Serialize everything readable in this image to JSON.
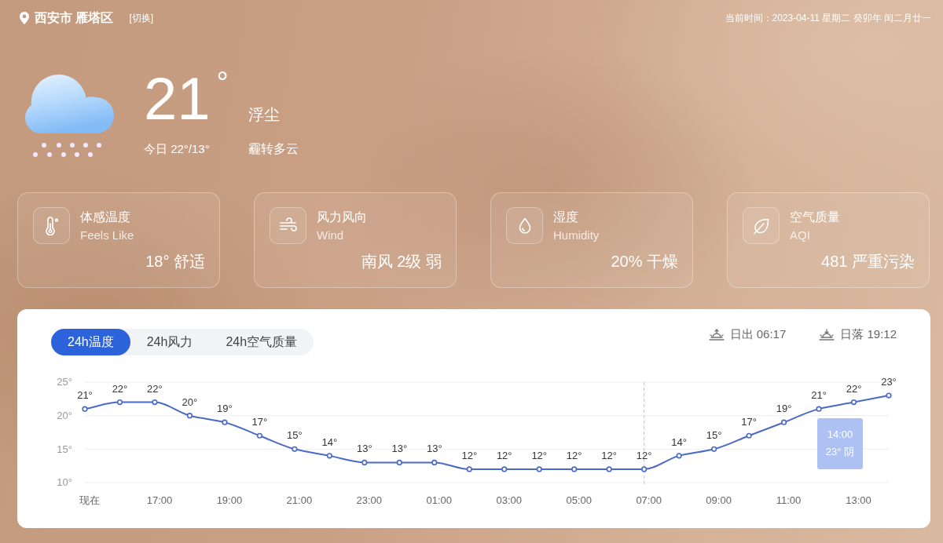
{
  "header": {
    "location": "西安市 雁塔区",
    "switch_link": "[切换]",
    "current_time": "当前时间：2023-04-11 星期二 癸卯年 闰二月廿一"
  },
  "current": {
    "temperature": "21",
    "unit": "°",
    "condition": "浮尘",
    "today_range": "今日 22°/13°",
    "forecast": "霾转多云"
  },
  "cards": [
    {
      "kind": "temperature",
      "title": "体感温度",
      "subtitle": "Feels Like",
      "value": "18° 舒适"
    },
    {
      "kind": "wind",
      "title": "风力风向",
      "subtitle": "Wind",
      "value": "南风 2级 弱"
    },
    {
      "kind": "humidity",
      "title": "湿度",
      "subtitle": "Humidity",
      "value": "20% 干燥"
    },
    {
      "kind": "air",
      "title": "空气质量",
      "subtitle": "AQI",
      "value": "481 严重污染"
    }
  ],
  "panel": {
    "tabs": [
      {
        "label": "24h温度",
        "selected": true
      },
      {
        "label": "24h风力",
        "selected": false
      },
      {
        "label": "24h空气质量",
        "selected": false
      }
    ],
    "sun": [
      {
        "kind": "sunrise",
        "text": "日出 06:17"
      },
      {
        "kind": "sunset",
        "text": "日落 19:12"
      }
    ],
    "chart_data": {
      "type": "line",
      "categories": [
        "现在",
        null,
        "17:00",
        null,
        "19:00",
        null,
        "21:00",
        null,
        "23:00",
        null,
        "01:00",
        null,
        "03:00",
        null,
        "05:00",
        null,
        "07:00",
        null,
        "09:00",
        null,
        "11:00",
        null,
        "13:00",
        null
      ],
      "series": [
        {
          "color": "#4a69c9",
          "marker": "circle",
          "values": [
            21,
            22,
            22,
            20,
            19,
            17,
            15,
            14,
            13,
            13,
            13,
            12,
            12,
            12,
            12,
            12,
            12,
            14,
            15,
            17,
            19,
            21,
            22,
            23
          ]
        }
      ],
      "value_labels": [
        "21°",
        "22°",
        "22°",
        "20°",
        "19°",
        "17°",
        "15°",
        "14°",
        "13°",
        "13°",
        "13°",
        "12°",
        "12°",
        "12°",
        "12°",
        "12°",
        "12°",
        "14°",
        "15°",
        "17°",
        "19°",
        "21°",
        "22°",
        "23°"
      ],
      "ylim": [
        10,
        25
      ],
      "yticks": [
        {
          "value": 10,
          "label": "10°"
        },
        {
          "value": 15,
          "label": "15°"
        },
        {
          "value": 20,
          "label": "20°"
        },
        {
          "value": 25,
          "label": "25°"
        }
      ],
      "ref_lines": [
        {
          "axis": "x",
          "value": "07:00"
        }
      ]
    },
    "tooltip": {
      "time": "14:00",
      "text": "23° 阴"
    }
  }
}
